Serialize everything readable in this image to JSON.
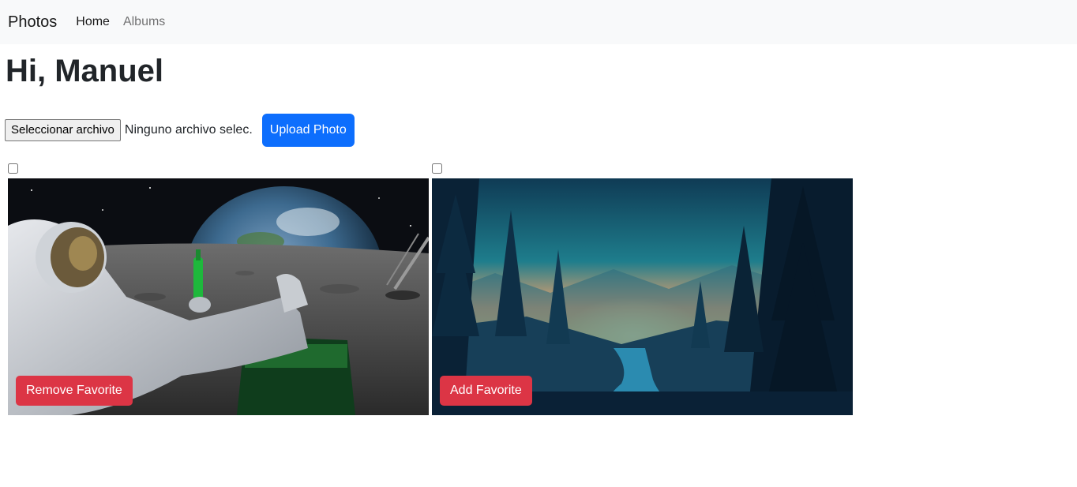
{
  "navbar": {
    "brand": "Photos",
    "links": [
      {
        "label": "Home",
        "active": true
      },
      {
        "label": "Albums",
        "active": false
      }
    ]
  },
  "greeting": "Hi, Manuel",
  "upload": {
    "file_button_label": "Seleccionar archivo",
    "file_status": "Ninguno archivo selec.",
    "submit_label": "Upload Photo"
  },
  "photos": [
    {
      "subject": "astronaut-on-moon",
      "favorite_label": "Remove Favorite",
      "checked": false
    },
    {
      "subject": "forest-sunset-river",
      "favorite_label": "Add Favorite",
      "checked": false
    }
  ],
  "colors": {
    "primary": "#0d6efd",
    "danger": "#dc3545",
    "navbar_bg": "#f8f9fa"
  }
}
